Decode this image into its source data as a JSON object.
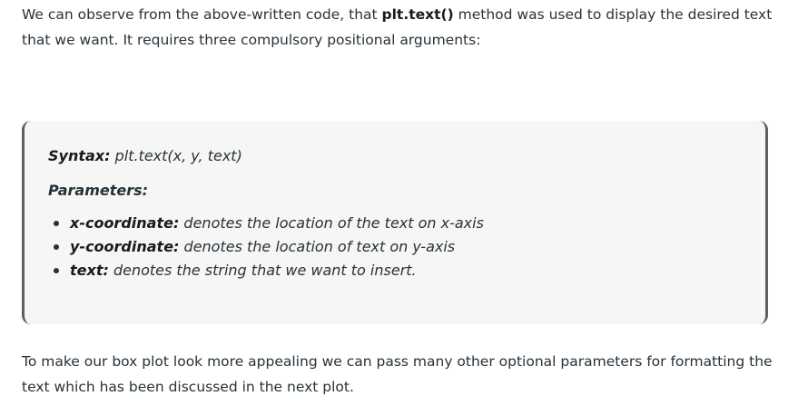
{
  "intro": {
    "before": "We can observe from the above-written code, that ",
    "code": "plt.text()",
    "after": " method was used to display the desired text that we want. It requires three compulsory positional arguments:"
  },
  "syntax_box": {
    "syntax_label": "Syntax:",
    "syntax_value": " plt.text(x, y, text)",
    "parameters_heading": "Parameters:",
    "parameters": [
      {
        "name": "x-coordinate:",
        "description": " denotes the location of the text on x-axis"
      },
      {
        "name": "y-coordinate:",
        "description": " denotes the location of text on y-axis"
      },
      {
        "name": "text:",
        "description": " denotes the string that we want to insert."
      }
    ]
  },
  "outro": {
    "text": "To make our box plot look more appealing we can pass many other optional parameters for formatting the text which has been discussed in the next plot."
  }
}
